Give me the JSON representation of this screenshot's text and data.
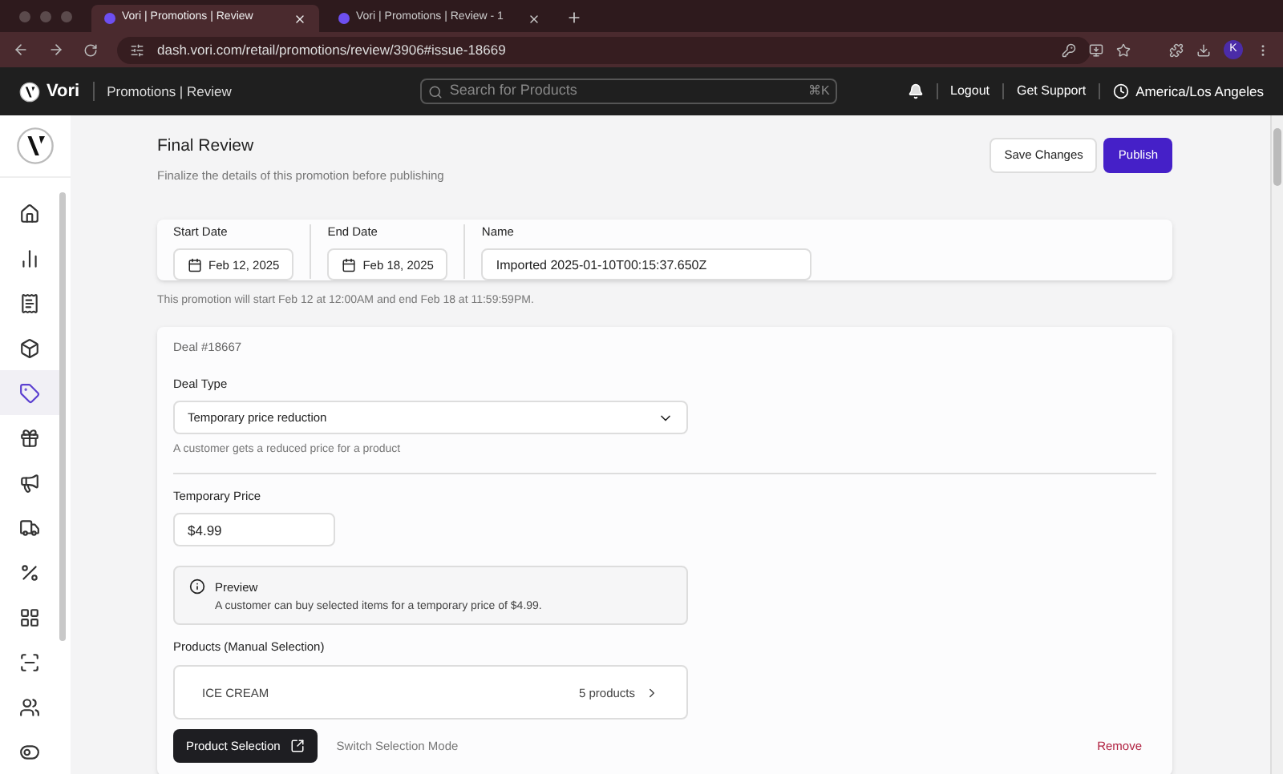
{
  "browser": {
    "tabs": [
      {
        "title": "Vori | Promotions | Review",
        "selected": true
      },
      {
        "title": "Vori | Promotions | Review - 1",
        "selected": false
      }
    ],
    "url": "dash.vori.com/retail/promotions/review/3906#issue-18669",
    "profile": "K"
  },
  "header": {
    "brand": "Vori",
    "section": "Promotions | Review",
    "search": {
      "placeholder": "Search for Products",
      "shortcut": "⌘K"
    },
    "links": [
      "Logout",
      "Get Support"
    ],
    "timezone": "America/Los Angeles"
  },
  "sidebar": {
    "items": [
      {
        "kind": "home",
        "selected": false
      },
      {
        "kind": "chart",
        "selected": false
      },
      {
        "kind": "receipt",
        "selected": false
      },
      {
        "kind": "box",
        "selected": false
      },
      {
        "kind": "tag",
        "selected": true
      },
      {
        "kind": "gift",
        "selected": false
      },
      {
        "kind": "megaphone",
        "selected": false
      },
      {
        "kind": "truck",
        "selected": false
      },
      {
        "kind": "percent",
        "selected": false
      },
      {
        "kind": "grid",
        "selected": false
      },
      {
        "kind": "scan",
        "selected": false
      },
      {
        "kind": "users",
        "selected": false
      },
      {
        "kind": "toggles",
        "selected": false
      }
    ]
  },
  "page": {
    "title": "Final Review",
    "subtitle": "Finalize the details of this promotion before publishing",
    "buttons": [
      "Save Changes",
      "Publish"
    ]
  },
  "dates": {
    "start": {
      "label": "Start Date",
      "value": "Feb 12, 2025"
    },
    "end": {
      "label": "End Date",
      "value": "Feb 18, 2025"
    },
    "name": {
      "label": "Name",
      "value": "Imported 2025-01-10T00:15:37.650Z"
    },
    "note": "This promotion will start Feb 12 at 12:00AM and end Feb 18 at 11:59:59PM."
  },
  "deal": {
    "number": "Deal #18667",
    "type_label": "Deal Type",
    "type_value": "Temporary price reduction",
    "type_hint": "A customer gets a reduced price for a product",
    "price_label": "Temporary Price",
    "price_value": "$4.99",
    "preview_title": "Preview",
    "preview_text": "A customer can buy selected items for a temporary price of $4.99.",
    "products_label": "Products (Manual Selection)",
    "products": [
      {
        "name": "ICE CREAM",
        "count": "5 products"
      }
    ],
    "buttons": [
      "Product Selection",
      "Switch Selection Mode",
      "Remove"
    ]
  }
}
